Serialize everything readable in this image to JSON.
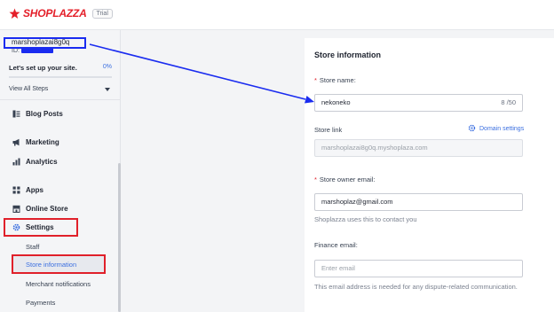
{
  "brand": {
    "name": "SHOPLAZZA",
    "badge": "Trial"
  },
  "sidebar": {
    "store_name": "marshoplazai8g0q",
    "id_label": "ID:",
    "setup_title": "Let's set up your site.",
    "setup_percent": "0%",
    "progress": 0,
    "view_steps": "View All Steps",
    "nav": {
      "blog": "Blog Posts",
      "marketing": "Marketing",
      "analytics": "Analytics",
      "apps": "Apps",
      "online_store": "Online Store",
      "settings": "Settings"
    },
    "settings_sub": {
      "staff": "Staff",
      "store_information": "Store information",
      "merchant_notifications": "Merchant notifications",
      "payments": "Payments"
    }
  },
  "main": {
    "title": "Store information",
    "store_name_label": "Store name:",
    "store_name_value": "nekoneko",
    "store_name_counter": "8 /50",
    "store_link_label": "Store link",
    "domain_settings": "Domain settings",
    "store_link_value": "marshoplazai8g0q.myshoplaza.com",
    "owner_email_label": "Store owner email:",
    "owner_email_value": "marshoplaz@gmail.com",
    "owner_email_helper": "Shoplazza uses this to contact you",
    "finance_email_label": "Finance email:",
    "finance_email_placeholder": "Enter email",
    "finance_email_helper": "This email address is needed for any dispute-related communication."
  },
  "colors": {
    "brand_red": "#e4202a",
    "accent_blue": "#3b6fe0",
    "annotation_blue": "#1a2cf0",
    "annotation_red": "#e0202a"
  }
}
